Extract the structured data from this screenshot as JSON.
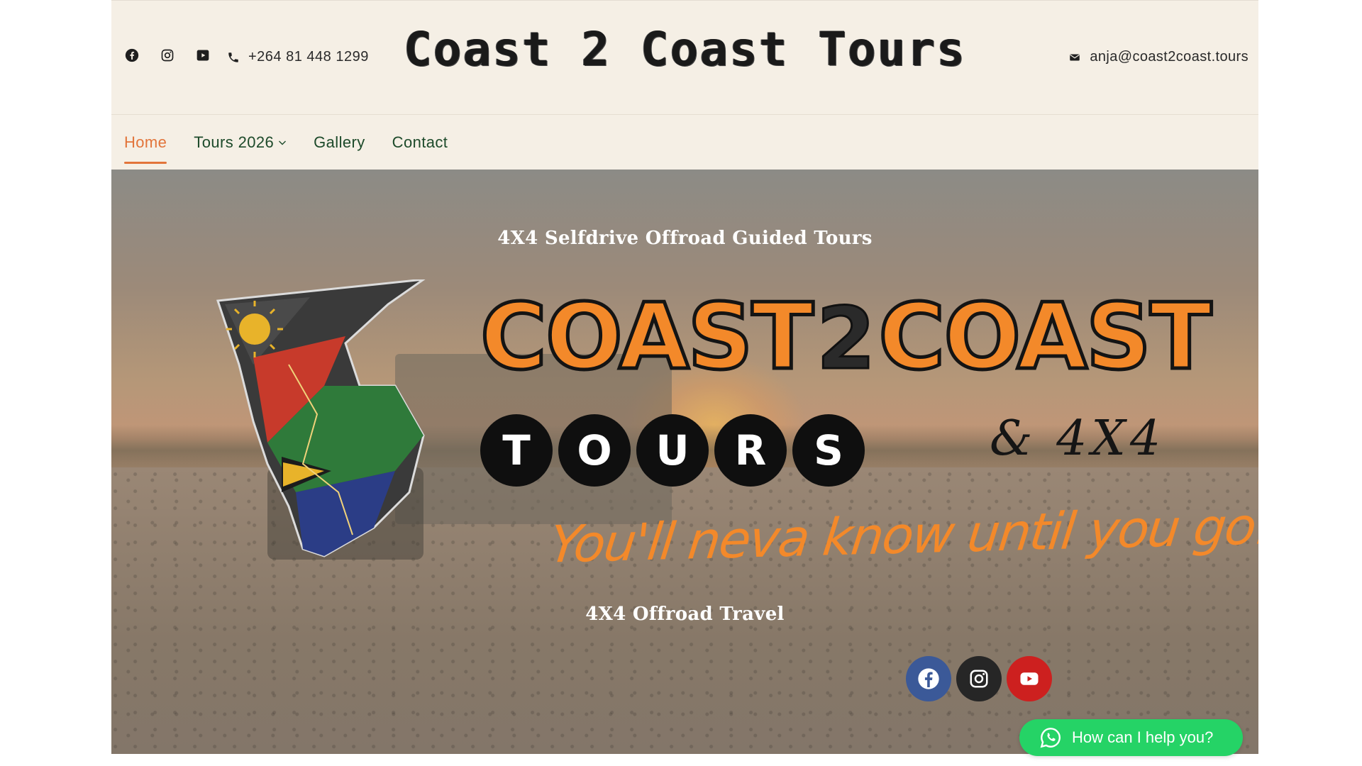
{
  "header": {
    "title": "Coast 2 Coast Tours",
    "phone": "+264 81 448 1299",
    "email": "anja@coast2coast.tours",
    "social_icons": [
      "facebook-icon",
      "instagram-icon",
      "youtube-icon"
    ]
  },
  "nav": {
    "items": [
      {
        "label": "Home",
        "active": true
      },
      {
        "label": "Tours 2026",
        "has_dropdown": true
      },
      {
        "label": "Gallery"
      },
      {
        "label": "Contact"
      }
    ]
  },
  "hero": {
    "subtitle_top": "4X4 Selfdrive Offroad Guided Tours",
    "logo": {
      "wordmark_left": "COAST",
      "wordmark_mid": "2",
      "wordmark_right": "COAST",
      "tours_letters": [
        "T",
        "O",
        "U",
        "R",
        "S"
      ],
      "suffix": "& 4X4",
      "tagline": "You'll neva know until you go!!"
    },
    "subtitle_bottom": "4X4 Offroad Travel",
    "social_buttons": [
      "facebook-icon",
      "instagram-icon",
      "youtube-icon"
    ]
  },
  "whatsapp": {
    "label": "How can I help you?"
  },
  "colors": {
    "accent_orange": "#e2743a",
    "nav_green": "#1d4a2a",
    "header_bg": "#f5efe5",
    "whatsapp_green": "#25d366"
  }
}
